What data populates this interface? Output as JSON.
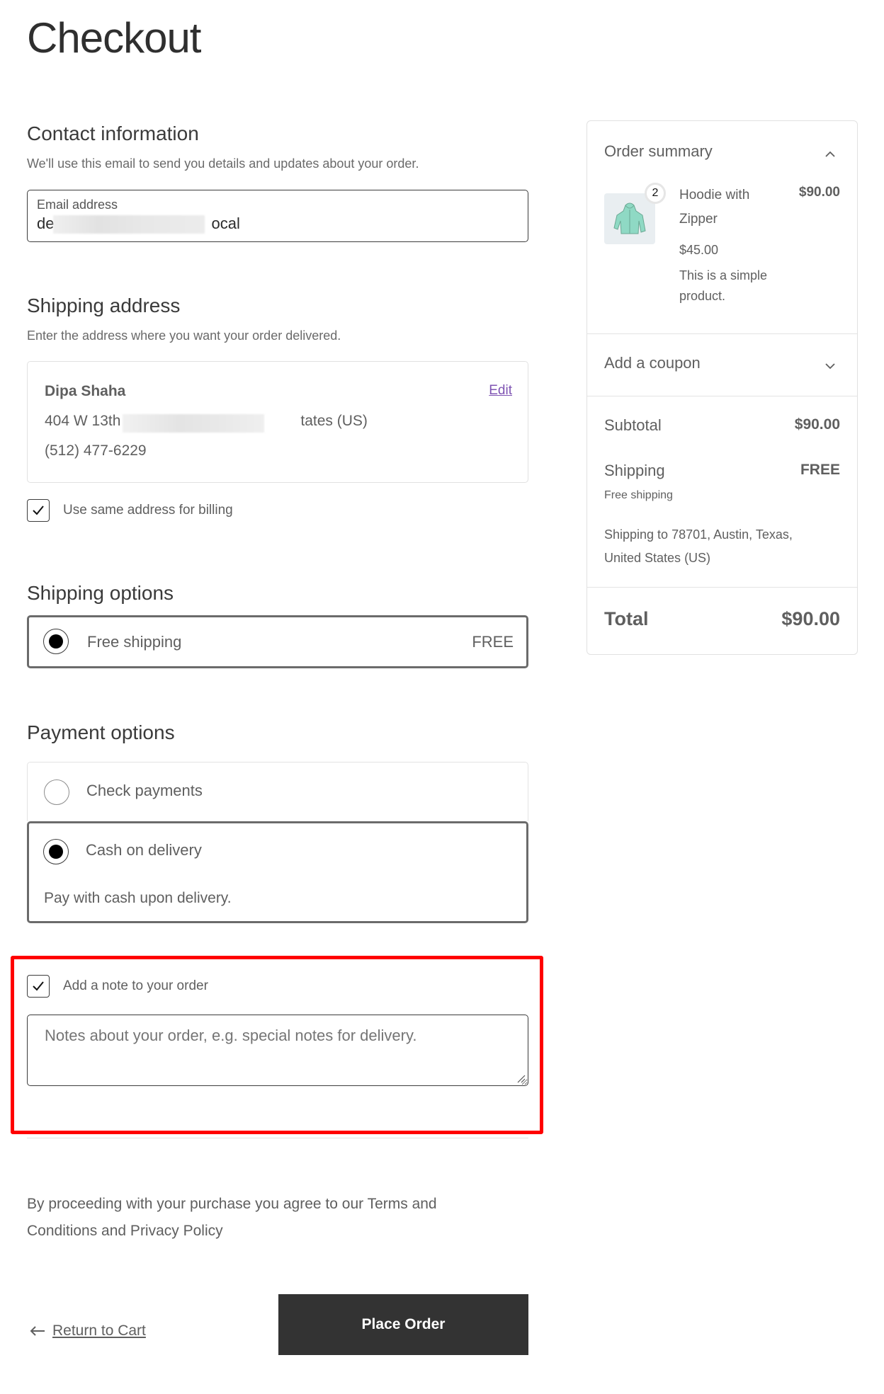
{
  "page": {
    "title": "Checkout"
  },
  "contact": {
    "heading": "Contact information",
    "description": "We'll use this email to send you details and updates about your order.",
    "email_label": "Email address",
    "email_value_start": "de",
    "email_value_end": "ocal"
  },
  "shipping_address": {
    "heading": "Shipping address",
    "description": "Enter the address where you want your order delivered.",
    "name": "Dipa Shaha",
    "address_start": "404 W 13th",
    "address_end": "tates (US)",
    "phone": "(512) 477-6229",
    "edit_label": "Edit",
    "same_billing_label": "Use same address for billing",
    "same_billing_checked": true
  },
  "shipping_options": {
    "heading": "Shipping options",
    "options": [
      {
        "label": "Free shipping",
        "price": "FREE",
        "selected": true
      }
    ]
  },
  "payment_options": {
    "heading": "Payment options",
    "options": [
      {
        "label": "Check payments",
        "selected": false
      },
      {
        "label": "Cash on delivery",
        "selected": true,
        "description": "Pay with cash upon delivery."
      }
    ]
  },
  "order_note": {
    "checkbox_label": "Add a note to your order",
    "checked": true,
    "placeholder": "Notes about your order, e.g. special notes for delivery."
  },
  "terms": "By proceeding with your purchase you agree to our Terms and Conditions and Privacy Policy",
  "actions": {
    "return_label": "Return to Cart",
    "place_order_label": "Place Order"
  },
  "colors": {
    "accent_link": "#7f54b3",
    "primary_button": "#333333",
    "highlight": "#ff0000"
  },
  "order_summary": {
    "heading": "Order summary",
    "items": [
      {
        "name": "Hoodie with Zipper",
        "quantity": "2",
        "line_total": "$90.00",
        "unit_price": "$45.00",
        "description": "This is a simple product."
      }
    ],
    "coupon_label": "Add a coupon",
    "subtotal_label": "Subtotal",
    "subtotal_value": "$90.00",
    "shipping_label": "Shipping",
    "shipping_value": "FREE",
    "shipping_method": "Free shipping",
    "shipping_to": "Shipping to 78701, Austin, Texas, United States (US)",
    "total_label": "Total",
    "total_value": "$90.00"
  }
}
